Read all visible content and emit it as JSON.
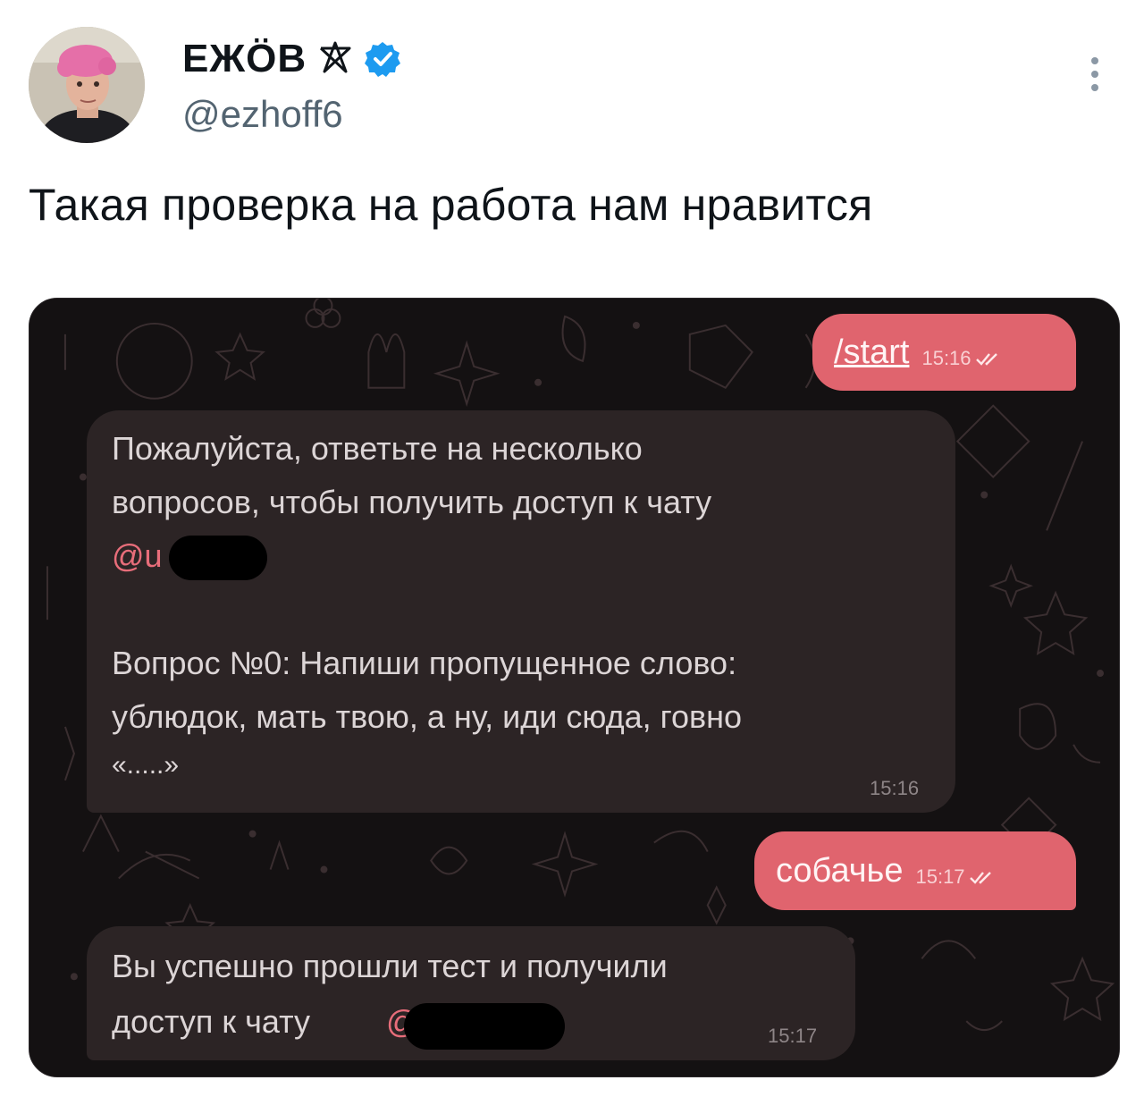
{
  "tweet": {
    "display_name": "ЕЖÖВ",
    "handle": "@ezhoff6",
    "text": "Такая проверка на работа нам нравится"
  },
  "icons": {
    "name_symbol": "pentagram-icon",
    "badge": "verified-badge-icon",
    "menu": "more-vertical-icon",
    "message_status": "double-check-icon"
  },
  "colors": {
    "verified": "#1d9bf0",
    "outgoing_bubble": "#e0646e",
    "incoming_bubble": "#2c2425",
    "chat_background": "#121011",
    "mention": "#e86d7a"
  },
  "chat": {
    "messages": [
      {
        "direction": "outgoing",
        "text": "/start",
        "time": "15:16"
      },
      {
        "direction": "incoming",
        "lines": [
          "Пожалуйста, ответьте на несколько",
          "вопросов, чтобы получить доступ к чату"
        ],
        "mention": "@u",
        "question": [
          "Вопрос №0: Напиши пропущенное слово:",
          "ублюдок, мать твою, а ну, иди сюда, говно",
          "«.....»"
        ],
        "time": "15:16"
      },
      {
        "direction": "outgoing",
        "text": "собачье",
        "time": "15:17"
      },
      {
        "direction": "incoming",
        "lines": [
          "Вы успешно прошли тест и получили",
          "доступ к чату"
        ],
        "mention": "@",
        "time": "15:17"
      }
    ]
  }
}
